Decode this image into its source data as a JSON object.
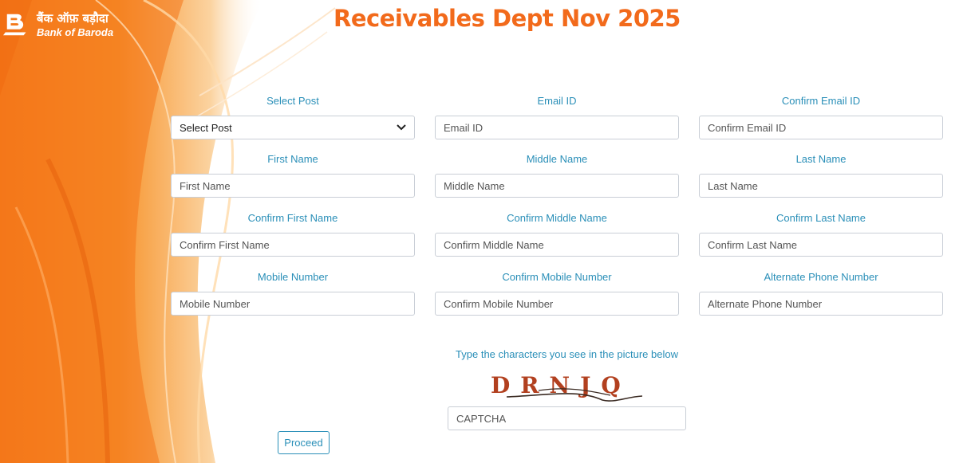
{
  "brand": {
    "name_hindi": "बैंक ऑफ़ बड़ौदा",
    "name_english": "Bank of Baroda",
    "logo_icon": "bank-of-baroda-logo-icon",
    "accent_color": "#f26a1b"
  },
  "page": {
    "title": "Receivables Dept Nov 2025"
  },
  "form": {
    "select_post": {
      "label": "Select Post",
      "value": "Select Post",
      "icon": "chevron-down-icon"
    },
    "email": {
      "label": "Email ID",
      "placeholder": "Email ID"
    },
    "confirm_email": {
      "label": "Confirm Email ID",
      "placeholder": "Confirm Email ID"
    },
    "first_name": {
      "label": "First Name",
      "placeholder": "First Name"
    },
    "middle_name": {
      "label": "Middle Name",
      "placeholder": "Middle Name"
    },
    "last_name": {
      "label": "Last Name",
      "placeholder": "Last Name"
    },
    "confirm_first_name": {
      "label": "Confirm First Name",
      "placeholder": "Confirm First Name"
    },
    "confirm_middle_name": {
      "label": "Confirm Middle Name",
      "placeholder": "Confirm Middle Name"
    },
    "confirm_last_name": {
      "label": "Confirm Last Name",
      "placeholder": "Confirm Last Name"
    },
    "mobile": {
      "label": "Mobile Number",
      "placeholder": "Mobile Number"
    },
    "confirm_mobile": {
      "label": "Confirm Mobile Number",
      "placeholder": "Confirm Mobile Number"
    },
    "alternate_phone": {
      "label": "Alternate Phone Number",
      "placeholder": "Alternate Phone Number"
    }
  },
  "captcha": {
    "instruction": "Type the characters you see in the picture below",
    "image_text": "DRNJQ",
    "placeholder": "CAPTCHA"
  },
  "actions": {
    "proceed_label": "Proceed"
  }
}
